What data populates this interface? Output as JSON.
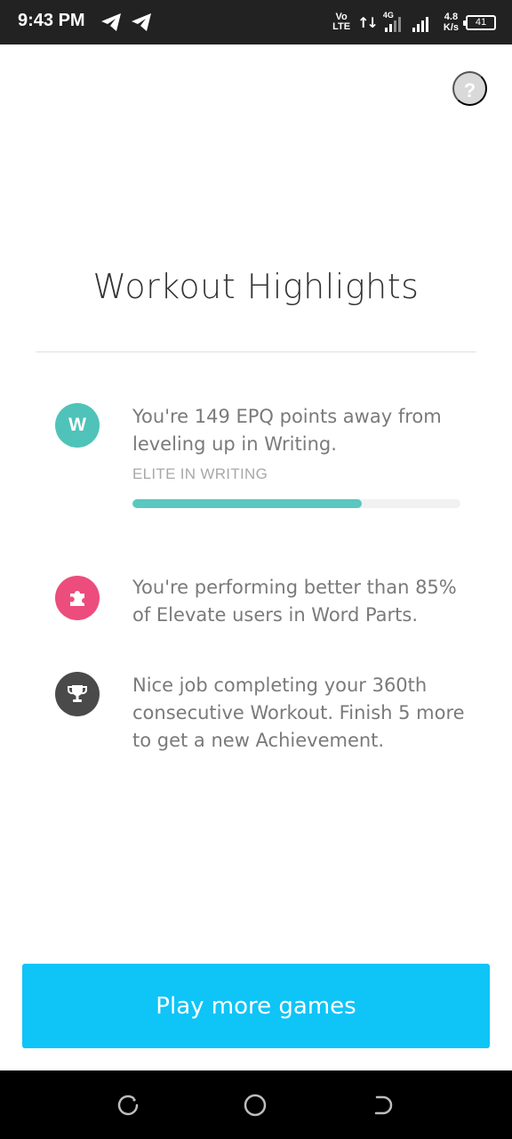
{
  "status_bar": {
    "time": "9:43 PM",
    "volte_top": "Vo",
    "volte_bottom": "LTE",
    "data_arrows": "↑↓",
    "network_type": "4G",
    "speed_value": "4.8",
    "speed_unit": "K/s",
    "battery": "41"
  },
  "help": {
    "label": "?"
  },
  "title": "Workout Highlights",
  "highlights": [
    {
      "icon": "letter-w-icon",
      "icon_text": "W",
      "icon_color": "#4fc3b9",
      "text": "You're 149 EPQ points away from leveling up in Writing."
    },
    {
      "icon": "puzzle-icon",
      "icon_color": "#ec4d7c",
      "text": "You're performing better than 85% of Elevate users in Word Parts."
    },
    {
      "icon": "trophy-icon",
      "icon_color": "#4a4a4a",
      "text": "Nice job completing your 360th consecutive Workout. Finish 5 more to get a new Achievement."
    }
  ],
  "level": {
    "label": "ELITE IN WRITING",
    "progress": 0.7,
    "fill_color": "#5ac8c0"
  },
  "cta": {
    "label": "Play more games",
    "color": "#0fc4f7"
  },
  "nav": [
    "recent-apps-icon",
    "home-icon",
    "back-icon"
  ]
}
